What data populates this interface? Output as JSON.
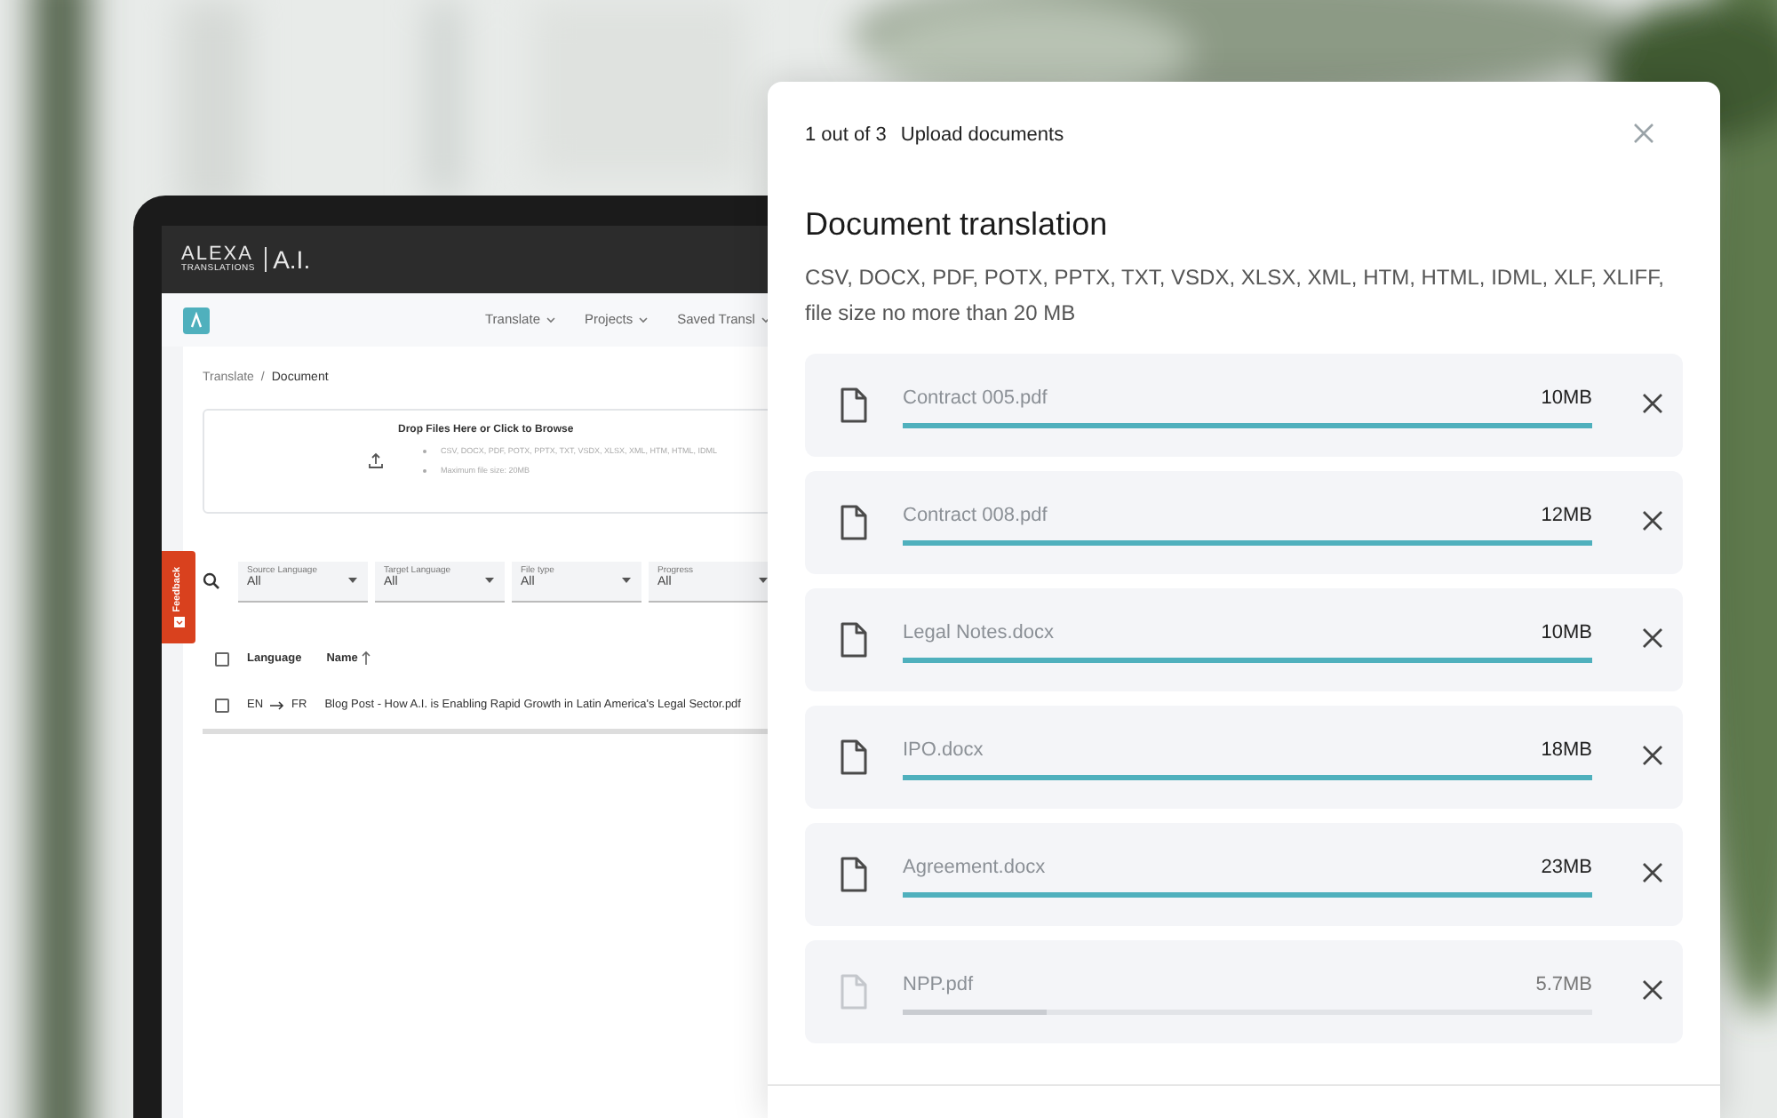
{
  "app": {
    "brand": {
      "name": "ALEXA",
      "tagline": "TRANSLATIONS",
      "suffix": "A.I."
    },
    "nav": [
      {
        "label": "Translate"
      },
      {
        "label": "Projects"
      },
      {
        "label": "Saved Transl"
      }
    ],
    "breadcrumb": {
      "items": [
        "Translate",
        "Document"
      ],
      "separator": "/"
    },
    "dropzone": {
      "title": "Drop Files Here or Click to Browse",
      "notes": [
        "CSV, DOCX, PDF, POTX, PPTX, TXT, VSDX, XLSX, XML, HTM, HTML, IDML",
        "Maximum file size: 20MB"
      ]
    },
    "feedback": "Feedback",
    "filters": [
      {
        "label": "Source Language",
        "value": "All"
      },
      {
        "label": "Target Language",
        "value": "All"
      },
      {
        "label": "File type",
        "value": "All"
      },
      {
        "label": "Progress",
        "value": "All"
      }
    ],
    "table": {
      "all_checked": false,
      "columns": [
        "Language",
        "Name"
      ],
      "rows": [
        {
          "checked": false,
          "source": "EN",
          "target": "FR",
          "name": "Blog Post - How A.I. is Enabling Rapid Growth in Latin America's Legal Sector.pdf"
        }
      ]
    }
  },
  "modal": {
    "step": "1 out of 3",
    "step_title": "Upload documents",
    "title": "Document translation",
    "description": "CSV, DOCX, PDF, POTX, PPTX, TXT, VSDX, XLSX, XML, HTM, HTML, IDML, XLF, XLIFF, file size no more than 20 MB",
    "files": [
      {
        "name": "Contract 005.pdf",
        "size": "10MB",
        "level": 1,
        "done": true
      },
      {
        "name": "Contract 008.pdf",
        "size": "12MB",
        "level": 1,
        "done": true
      },
      {
        "name": "Legal Notes.docx",
        "size": "10MB",
        "level": 1,
        "done": true
      },
      {
        "name": "IPO.docx",
        "size": "18MB",
        "level": 1,
        "done": true
      },
      {
        "name": "Agreement.docx",
        "size": "23MB",
        "level": 1,
        "done": true
      },
      {
        "name": "NPP.pdf",
        "size": "5.7MB",
        "level": 0.21,
        "done": false
      }
    ]
  }
}
